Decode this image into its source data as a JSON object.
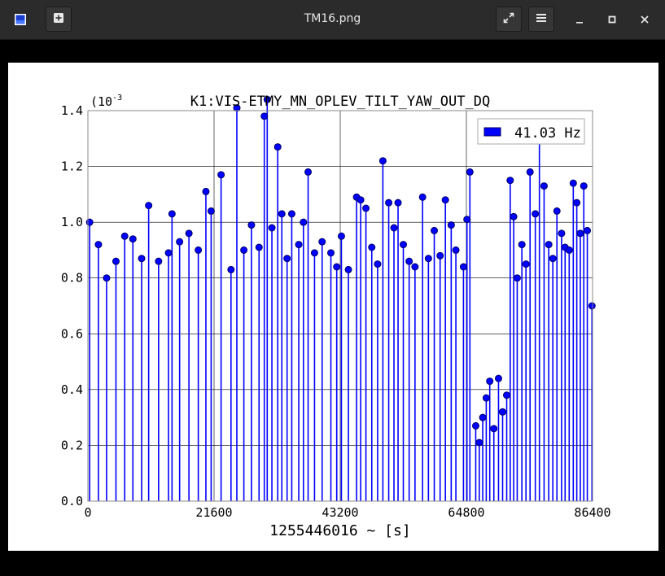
{
  "window": {
    "title": "TM16.png",
    "icons": {
      "app": "image-viewer-icon",
      "new": "new-tab-icon",
      "fullscreen": "fullscreen-icon",
      "menu": "hamburger-menu-icon",
      "minimize": "minimize-icon",
      "maximize": "maximize-icon",
      "close": "close-icon"
    }
  },
  "chart_data": {
    "type": "scatter",
    "style": "stem",
    "title": "K1:VIS-ETMY_MN_OPLEV_TILT_YAW_OUT_DQ",
    "exponent_label": "(10",
    "exponent_power": "-3",
    "xlabel": "1255446016 ~ [s]",
    "xlim": [
      0,
      86400
    ],
    "ylim": [
      0,
      1.4
    ],
    "xticks": [
      0,
      21600,
      43200,
      64800,
      86400
    ],
    "xtick_labels": [
      "0",
      "21600",
      "43200",
      "64800",
      "86400"
    ],
    "yticks": [
      0,
      0.2,
      0.4,
      0.6,
      0.8,
      1.0,
      1.2,
      1.4
    ],
    "ytick_labels": [
      "0.0",
      "0.2",
      "0.4",
      "0.6",
      "0.8",
      "1.0",
      "1.2",
      "1.4"
    ],
    "grid": true,
    "legend_position": "top-right",
    "series": [
      {
        "name": "41.03 Hz",
        "color": "#0000ff",
        "edge_color": "#000066",
        "points": [
          [
            300,
            1.0
          ],
          [
            1800,
            0.92
          ],
          [
            3200,
            0.8
          ],
          [
            4800,
            0.86
          ],
          [
            6300,
            0.95
          ],
          [
            7700,
            0.94
          ],
          [
            9200,
            0.87
          ],
          [
            10400,
            1.06
          ],
          [
            12100,
            0.86
          ],
          [
            13800,
            0.89
          ],
          [
            14400,
            1.03
          ],
          [
            15700,
            0.93
          ],
          [
            17300,
            0.96
          ],
          [
            18900,
            0.9
          ],
          [
            20200,
            1.11
          ],
          [
            21100,
            1.04
          ],
          [
            22800,
            1.17
          ],
          [
            24500,
            0.83
          ],
          [
            25500,
            1.41
          ],
          [
            26700,
            0.9
          ],
          [
            28000,
            0.99
          ],
          [
            29300,
            0.91
          ],
          [
            30200,
            1.38
          ],
          [
            30700,
            1.44
          ],
          [
            31500,
            0.98
          ],
          [
            32500,
            1.27
          ],
          [
            33200,
            1.03
          ],
          [
            34100,
            0.87
          ],
          [
            34900,
            1.03
          ],
          [
            36100,
            0.92
          ],
          [
            36900,
            1.0
          ],
          [
            37700,
            1.18
          ],
          [
            38800,
            0.89
          ],
          [
            40100,
            0.93
          ],
          [
            41600,
            0.89
          ],
          [
            42600,
            0.84
          ],
          [
            43400,
            0.95
          ],
          [
            44600,
            0.83
          ],
          [
            46000,
            1.09
          ],
          [
            46700,
            1.08
          ],
          [
            47600,
            1.05
          ],
          [
            48600,
            0.91
          ],
          [
            49600,
            0.85
          ],
          [
            50500,
            1.22
          ],
          [
            51500,
            1.07
          ],
          [
            52400,
            0.98
          ],
          [
            53100,
            1.07
          ],
          [
            54000,
            0.92
          ],
          [
            55000,
            0.86
          ],
          [
            56000,
            0.84
          ],
          [
            57300,
            1.09
          ],
          [
            58300,
            0.87
          ],
          [
            59300,
            0.97
          ],
          [
            60300,
            0.88
          ],
          [
            61200,
            1.08
          ],
          [
            62200,
            0.99
          ],
          [
            63000,
            0.9
          ],
          [
            64300,
            0.84
          ],
          [
            64900,
            1.01
          ],
          [
            65400,
            1.18
          ],
          [
            66400,
            0.27
          ],
          [
            67000,
            0.21
          ],
          [
            67600,
            0.3
          ],
          [
            68200,
            0.37
          ],
          [
            68800,
            0.43
          ],
          [
            69500,
            0.26
          ],
          [
            70300,
            0.44
          ],
          [
            71000,
            0.32
          ],
          [
            71700,
            0.38
          ],
          [
            72300,
            1.15
          ],
          [
            72900,
            1.02
          ],
          [
            73500,
            0.8
          ],
          [
            74300,
            0.92
          ],
          [
            75000,
            0.85
          ],
          [
            75700,
            1.18
          ],
          [
            76600,
            1.03
          ],
          [
            77300,
            1.32
          ],
          [
            78100,
            1.13
          ],
          [
            78900,
            0.92
          ],
          [
            79600,
            0.87
          ],
          [
            80300,
            1.04
          ],
          [
            81100,
            0.96
          ],
          [
            81700,
            0.91
          ],
          [
            82400,
            0.9
          ],
          [
            83100,
            1.14
          ],
          [
            83700,
            1.07
          ],
          [
            84300,
            0.96
          ],
          [
            84900,
            1.13
          ],
          [
            85500,
            0.97
          ],
          [
            86300,
            0.7
          ]
        ]
      }
    ]
  }
}
